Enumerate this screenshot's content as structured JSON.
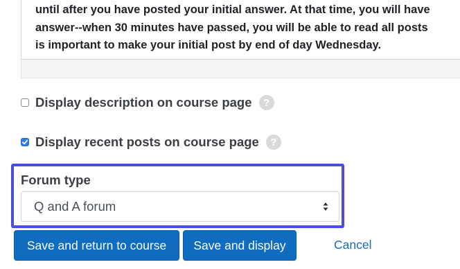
{
  "description": {
    "lines": [
      "until after you have posted your initial answer. At that time, you will have",
      "answer--when 30 minutes have passed, you will be able to read all posts",
      "is important to make your initial post by end of day Wednesday."
    ]
  },
  "options": {
    "display_description": {
      "label": "Display description on course page",
      "checked": false,
      "help": "?"
    },
    "display_recent_posts": {
      "label": "Display recent posts on course page",
      "checked": true,
      "help": "?"
    }
  },
  "forum_type": {
    "label": "Forum type",
    "selected": "Q and A forum"
  },
  "actions": {
    "save_return": "Save and return to course",
    "save_display": "Save and display",
    "cancel": "Cancel"
  },
  "colors": {
    "primary": "#0f6cbf",
    "highlight": "#4a4ee0",
    "checkbox_checked": "#2f7ae5"
  }
}
